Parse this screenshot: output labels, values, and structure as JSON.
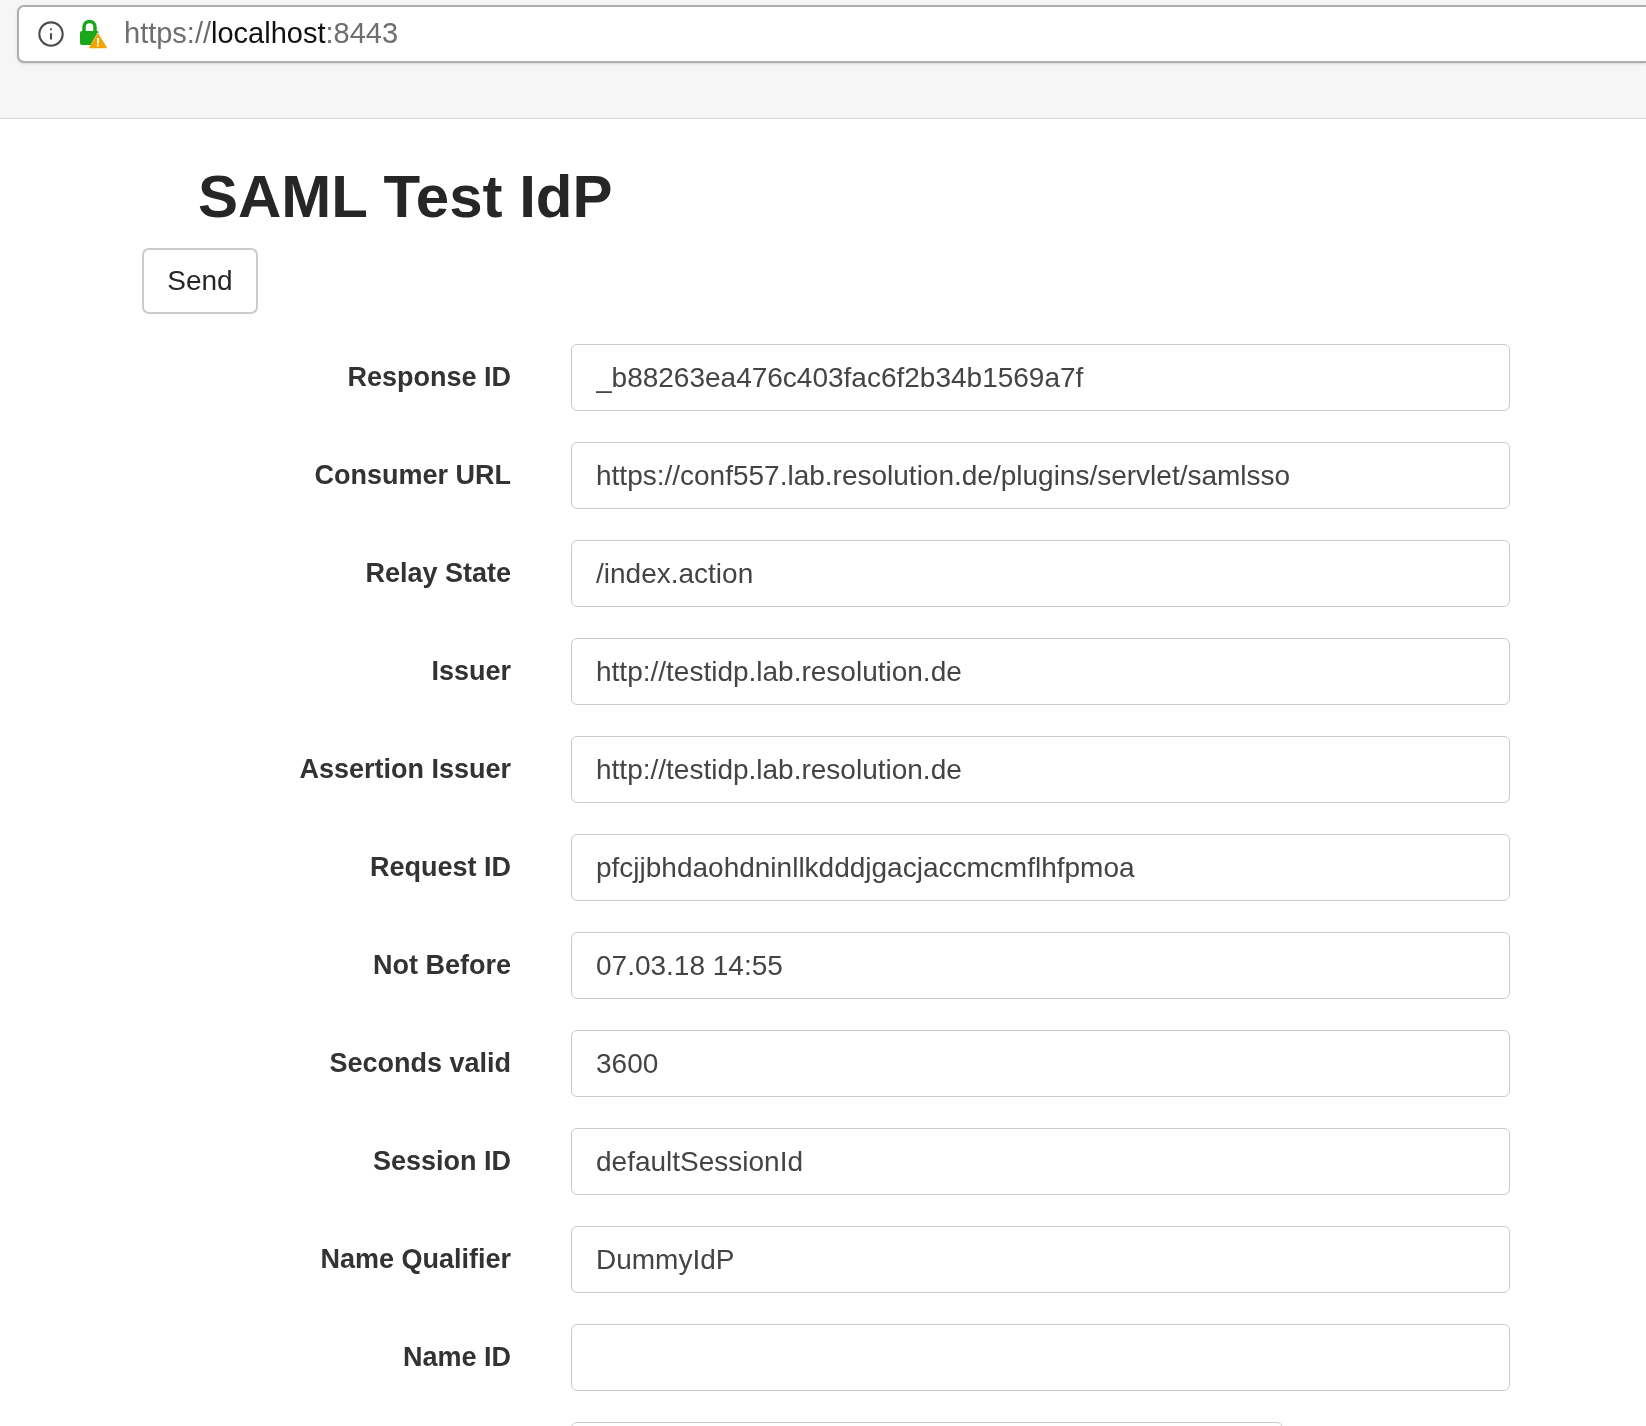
{
  "address_bar": {
    "scheme": "https://",
    "host": "localhost",
    "port": ":8443"
  },
  "page": {
    "title": "SAML Test IdP",
    "send_button": "Send"
  },
  "fields": [
    {
      "kind": "text",
      "label": "Response ID",
      "value": "_b88263ea476c403fac6f2b34b1569a7f"
    },
    {
      "kind": "text",
      "label": "Consumer URL",
      "value": "https://conf557.lab.resolution.de/plugins/servlet/samlsso"
    },
    {
      "kind": "text",
      "label": "Relay State",
      "value": "/index.action"
    },
    {
      "kind": "text",
      "label": "Issuer",
      "value": "http://testidp.lab.resolution.de"
    },
    {
      "kind": "text",
      "label": "Assertion Issuer",
      "value": "http://testidp.lab.resolution.de"
    },
    {
      "kind": "text",
      "label": "Request ID",
      "value": "pfcjjbhdaohdninllkdddjgacjaccmcmflhfpmoa"
    },
    {
      "kind": "text",
      "label": "Not Before",
      "value": "07.03.18 14:55"
    },
    {
      "kind": "text",
      "label": "Seconds valid",
      "value": "3600"
    },
    {
      "kind": "text",
      "label": "Session ID",
      "value": "defaultSessionId"
    },
    {
      "kind": "text",
      "label": "Name Qualifier",
      "value": "DummyIdP"
    },
    {
      "kind": "text",
      "label": "Name ID"
    },
    {
      "kind": "partial"
    }
  ]
}
